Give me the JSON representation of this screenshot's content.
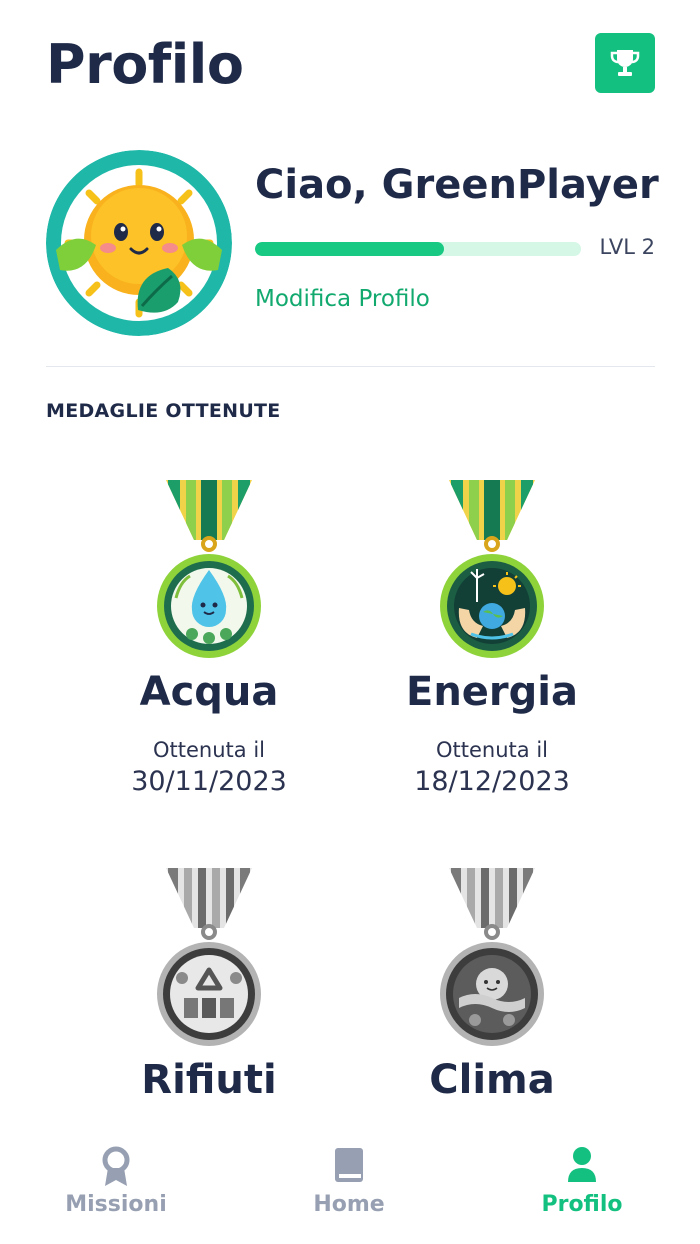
{
  "header": {
    "title": "Profilo"
  },
  "profile": {
    "greeting": "Ciao, GreenPlayer",
    "level": "LVL 2",
    "xp_progress": 0.58,
    "edit_label": "Modifica Profilo"
  },
  "medals": {
    "section_title": "MEDAGLIE OTTENUTE",
    "items": [
      {
        "name": "Acqua",
        "caption": "Ottenuta il",
        "date": "30/11/2023",
        "unlocked": true
      },
      {
        "name": "Energia",
        "caption": "Ottenuta il",
        "date": "18/12/2023",
        "unlocked": true
      },
      {
        "name": "Rifiuti",
        "unlocked": false
      },
      {
        "name": "Clima",
        "unlocked": false
      }
    ]
  },
  "nav": {
    "items": [
      {
        "label": "Missioni",
        "icon": "ribbon-icon",
        "active": false
      },
      {
        "label": "Home",
        "icon": "book-icon",
        "active": false
      },
      {
        "label": "Profilo",
        "icon": "person-icon",
        "active": true
      }
    ]
  },
  "colors": {
    "accent": "#14c07f",
    "text": "#1f2a48",
    "inactive": "#97a0b2"
  }
}
